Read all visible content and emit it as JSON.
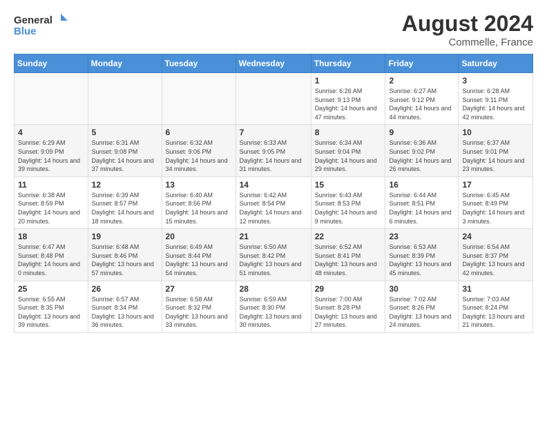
{
  "header": {
    "logo_general": "General",
    "logo_blue": "Blue",
    "month_year": "August 2024",
    "location": "Commelle, France"
  },
  "weekdays": [
    "Sunday",
    "Monday",
    "Tuesday",
    "Wednesday",
    "Thursday",
    "Friday",
    "Saturday"
  ],
  "weeks": [
    [
      {
        "day": "",
        "info": ""
      },
      {
        "day": "",
        "info": ""
      },
      {
        "day": "",
        "info": ""
      },
      {
        "day": "",
        "info": ""
      },
      {
        "day": "1",
        "info": "Sunrise: 6:26 AM\nSunset: 9:13 PM\nDaylight: 14 hours and 47 minutes."
      },
      {
        "day": "2",
        "info": "Sunrise: 6:27 AM\nSunset: 9:12 PM\nDaylight: 14 hours and 44 minutes."
      },
      {
        "day": "3",
        "info": "Sunrise: 6:28 AM\nSunset: 9:11 PM\nDaylight: 14 hours and 42 minutes."
      }
    ],
    [
      {
        "day": "4",
        "info": "Sunrise: 6:29 AM\nSunset: 9:09 PM\nDaylight: 14 hours and 39 minutes."
      },
      {
        "day": "5",
        "info": "Sunrise: 6:31 AM\nSunset: 9:08 PM\nDaylight: 14 hours and 37 minutes."
      },
      {
        "day": "6",
        "info": "Sunrise: 6:32 AM\nSunset: 9:06 PM\nDaylight: 14 hours and 34 minutes."
      },
      {
        "day": "7",
        "info": "Sunrise: 6:33 AM\nSunset: 9:05 PM\nDaylight: 14 hours and 31 minutes."
      },
      {
        "day": "8",
        "info": "Sunrise: 6:34 AM\nSunset: 9:04 PM\nDaylight: 14 hours and 29 minutes."
      },
      {
        "day": "9",
        "info": "Sunrise: 6:36 AM\nSunset: 9:02 PM\nDaylight: 14 hours and 26 minutes."
      },
      {
        "day": "10",
        "info": "Sunrise: 6:37 AM\nSunset: 9:01 PM\nDaylight: 14 hours and 23 minutes."
      }
    ],
    [
      {
        "day": "11",
        "info": "Sunrise: 6:38 AM\nSunset: 8:59 PM\nDaylight: 14 hours and 20 minutes."
      },
      {
        "day": "12",
        "info": "Sunrise: 6:39 AM\nSunset: 8:57 PM\nDaylight: 14 hours and 18 minutes."
      },
      {
        "day": "13",
        "info": "Sunrise: 6:40 AM\nSunset: 8:56 PM\nDaylight: 14 hours and 15 minutes."
      },
      {
        "day": "14",
        "info": "Sunrise: 6:42 AM\nSunset: 8:54 PM\nDaylight: 14 hours and 12 minutes."
      },
      {
        "day": "15",
        "info": "Sunrise: 6:43 AM\nSunset: 8:53 PM\nDaylight: 14 hours and 9 minutes."
      },
      {
        "day": "16",
        "info": "Sunrise: 6:44 AM\nSunset: 8:51 PM\nDaylight: 14 hours and 6 minutes."
      },
      {
        "day": "17",
        "info": "Sunrise: 6:45 AM\nSunset: 8:49 PM\nDaylight: 14 hours and 3 minutes."
      }
    ],
    [
      {
        "day": "18",
        "info": "Sunrise: 6:47 AM\nSunset: 8:48 PM\nDaylight: 14 hours and 0 minutes."
      },
      {
        "day": "19",
        "info": "Sunrise: 6:48 AM\nSunset: 8:46 PM\nDaylight: 13 hours and 57 minutes."
      },
      {
        "day": "20",
        "info": "Sunrise: 6:49 AM\nSunset: 8:44 PM\nDaylight: 13 hours and 54 minutes."
      },
      {
        "day": "21",
        "info": "Sunrise: 6:50 AM\nSunset: 8:42 PM\nDaylight: 13 hours and 51 minutes."
      },
      {
        "day": "22",
        "info": "Sunrise: 6:52 AM\nSunset: 8:41 PM\nDaylight: 13 hours and 48 minutes."
      },
      {
        "day": "23",
        "info": "Sunrise: 6:53 AM\nSunset: 8:39 PM\nDaylight: 13 hours and 45 minutes."
      },
      {
        "day": "24",
        "info": "Sunrise: 6:54 AM\nSunset: 8:37 PM\nDaylight: 13 hours and 42 minutes."
      }
    ],
    [
      {
        "day": "25",
        "info": "Sunrise: 6:55 AM\nSunset: 8:35 PM\nDaylight: 13 hours and 39 minutes."
      },
      {
        "day": "26",
        "info": "Sunrise: 6:57 AM\nSunset: 8:34 PM\nDaylight: 13 hours and 36 minutes."
      },
      {
        "day": "27",
        "info": "Sunrise: 6:58 AM\nSunset: 8:32 PM\nDaylight: 13 hours and 33 minutes."
      },
      {
        "day": "28",
        "info": "Sunrise: 6:59 AM\nSunset: 8:30 PM\nDaylight: 13 hours and 30 minutes."
      },
      {
        "day": "29",
        "info": "Sunrise: 7:00 AM\nSunset: 8:28 PM\nDaylight: 13 hours and 27 minutes."
      },
      {
        "day": "30",
        "info": "Sunrise: 7:02 AM\nSunset: 8:26 PM\nDaylight: 13 hours and 24 minutes."
      },
      {
        "day": "31",
        "info": "Sunrise: 7:03 AM\nSunset: 8:24 PM\nDaylight: 13 hours and 21 minutes."
      }
    ]
  ]
}
